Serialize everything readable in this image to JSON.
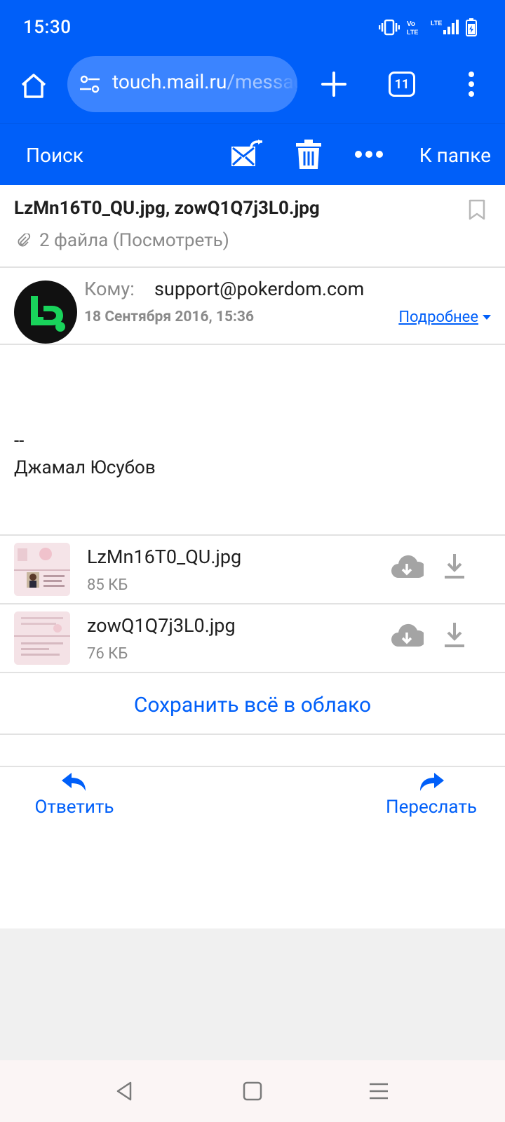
{
  "status_bar": {
    "time": "15:30",
    "tabs_count": "11"
  },
  "browser": {
    "url_main": "touch.mail.ru",
    "url_rest": "/message"
  },
  "toolbar": {
    "search_label": "Поиск",
    "folder_label": "К папке"
  },
  "message": {
    "subject": "LzMn16T0_QU.jpg, zowQ1Q7j3L0.jpg",
    "attachments_summary": "2 файла (Посмотреть)",
    "to_label": "Кому:",
    "to_value": "support@pokerdom.com",
    "date": "18 Сентября 2016, 15:36",
    "details_label": "Подробнее",
    "signature_dash": "--",
    "signature_name": "Джамал Юсубов"
  },
  "attachments": [
    {
      "name": "LzMn16T0_QU.jpg",
      "size": "85 КБ"
    },
    {
      "name": "zowQ1Q7j3L0.jpg",
      "size": "76 КБ"
    }
  ],
  "save_all_label": "Сохранить всё в облако",
  "actions": {
    "reply_label": "Ответить",
    "forward_label": "Переслать"
  },
  "colors": {
    "accent": "#005ff9",
    "avatar_green": "#19d35b"
  }
}
